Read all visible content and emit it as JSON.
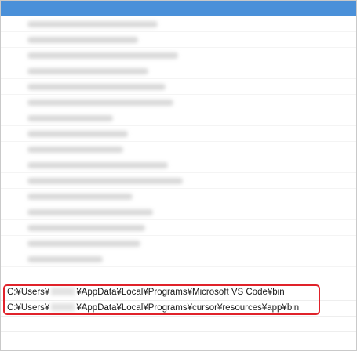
{
  "list": {
    "selected_color": "#4a90d9",
    "blurred_rows": [
      0.52,
      0.44,
      0.6,
      0.48,
      0.55,
      0.58,
      0.34,
      0.4,
      0.38,
      0.56,
      0.62,
      0.42,
      0.5,
      0.47,
      0.45,
      0.3
    ],
    "paths": [
      {
        "prefix": "C:¥Users¥",
        "suffix": "¥AppData¥Local¥Programs¥Microsoft VS Code¥bin"
      },
      {
        "prefix": "C:¥Users¥",
        "suffix": "¥AppData¥Local¥Programs¥cursor¥resources¥app¥bin"
      }
    ]
  },
  "annotation": {
    "highlight_color": "#e0222a"
  }
}
